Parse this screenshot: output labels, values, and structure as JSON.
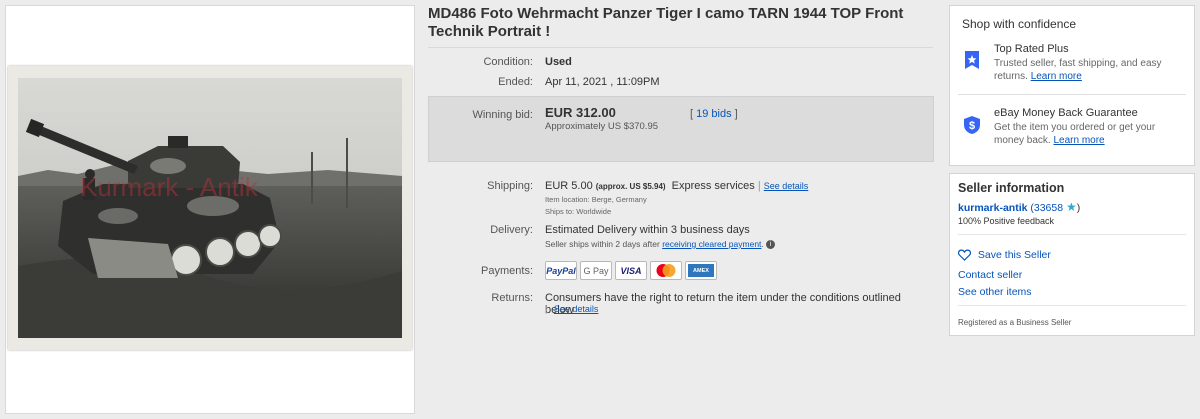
{
  "listing": {
    "title": "MD486 Foto Wehrmacht Panzer Tiger I camo TARN 1944 TOP Front Technik Portrait !",
    "photo_watermark": "Kurmark - Antik"
  },
  "details": {
    "condition_label": "Condition:",
    "condition_value": "Used",
    "ended_label": "Ended:",
    "ended_value": "Apr 11, 2021 , 11:09PM",
    "winning_bid_label": "Winning bid:",
    "winning_bid_value": "EUR 312.00",
    "winning_bid_approx": "Approximately US $370.95",
    "bids_open": "[",
    "bids_link": "19 bids",
    "bids_close": "]",
    "shipping_label": "Shipping:",
    "shipping_value": "EUR 5.00",
    "shipping_approx": "(approx. US $5.94)",
    "shipping_service": "Express services",
    "shipping_sep": "|",
    "shipping_details_link": "See details",
    "item_location": "Item location:  Berge, Germany",
    "ships_to": "Ships to:  Worldwide",
    "delivery_label": "Delivery:",
    "delivery_value": "Estimated Delivery within 3 business days",
    "delivery_note": "Seller ships within 2 days after",
    "delivery_note_link": "receiving cleared payment",
    "delivery_note_end": ".",
    "payments_label": "Payments:",
    "payment_methods": [
      "PayPal",
      "G Pay",
      "VISA",
      "Mastercard",
      "AMEX"
    ],
    "returns_label": "Returns:",
    "returns_value": "Consumers have the right to return the item under the conditions outlined below",
    "returns_sep": "|",
    "returns_details_link": "See details"
  },
  "confidence": {
    "heading": "Shop with confidence",
    "top_rated_title": "Top Rated Plus",
    "top_rated_desc": "Trusted seller, fast shipping, and easy returns.",
    "top_rated_link": "Learn more",
    "mbg_title": "eBay Money Back Guarantee",
    "mbg_desc": "Get the item you ordered or get your money back.",
    "mbg_link": "Learn more"
  },
  "seller": {
    "heading": "Seller information",
    "name": "kurmark-antik",
    "feedback_open": "(33658",
    "feedback_close": ")",
    "positive": "100% Positive feedback",
    "save_seller": "Save this Seller",
    "contact": "Contact seller",
    "other_items": "See other items",
    "registered": "Registered as a Business Seller"
  },
  "colors": {
    "link": "#0654ba",
    "shield": "#3665f3",
    "star_badge": "#2fa8d6",
    "watermark": "#b8323c"
  }
}
